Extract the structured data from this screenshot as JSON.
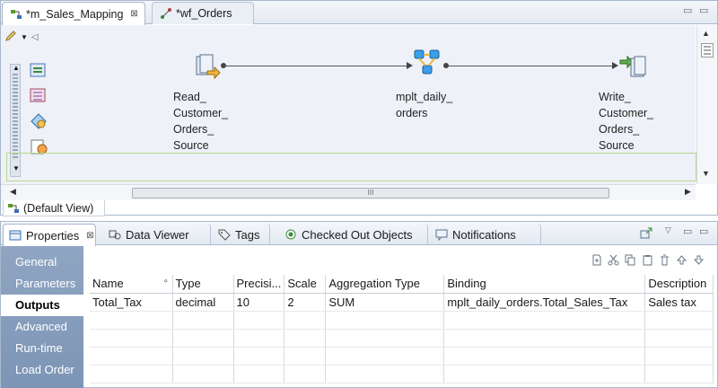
{
  "editor": {
    "tabs": [
      {
        "label": "*m_Sales_Mapping",
        "close": "⊠",
        "icon": "mapping-icon"
      },
      {
        "label": "*wf_Orders",
        "icon": "workflow-icon"
      }
    ],
    "window_controls": [
      "▭",
      "▭"
    ],
    "nodes": [
      {
        "label": "Read_\nCustomer_\nOrders_\nSource",
        "icon": "read-source-icon"
      },
      {
        "label": "mplt_daily_\norders",
        "icon": "mapplet-icon"
      },
      {
        "label": "Write_\nCustomer_\nOrders_\nSource",
        "icon": "write-target-icon"
      }
    ],
    "scroll_grip": "III",
    "default_view_label": "(Default View)"
  },
  "properties": {
    "tabs": [
      {
        "label": "Properties",
        "close": "⊠",
        "icon": "properties-icon"
      },
      {
        "label": "Data Viewer",
        "icon": "data-viewer-icon"
      },
      {
        "label": "Tags",
        "icon": "tag-icon"
      },
      {
        "label": "Checked Out Objects",
        "icon": "checked-out-icon"
      },
      {
        "label": "Notifications",
        "icon": "notifications-icon"
      }
    ],
    "sidebar": [
      {
        "label": "General"
      },
      {
        "label": "Parameters"
      },
      {
        "label": "Outputs",
        "active": true
      },
      {
        "label": "Advanced"
      },
      {
        "label": "Run-time"
      },
      {
        "label": "Load Order"
      }
    ],
    "table": {
      "columns": [
        "Name",
        "Type",
        "Precisi...",
        "Scale",
        "Aggregation Type",
        "Binding",
        "Description"
      ],
      "rows": [
        [
          "Total_Tax",
          "decimal",
          "10",
          "2",
          "SUM",
          "mplt_daily_orders.Total_Sales_Tax",
          "Sales tax"
        ]
      ]
    }
  },
  "colors": {
    "sidebar_bg": "#8fa5c2",
    "canvas_bg": "#eef1f7",
    "accent_border": "#a9b8cc"
  }
}
